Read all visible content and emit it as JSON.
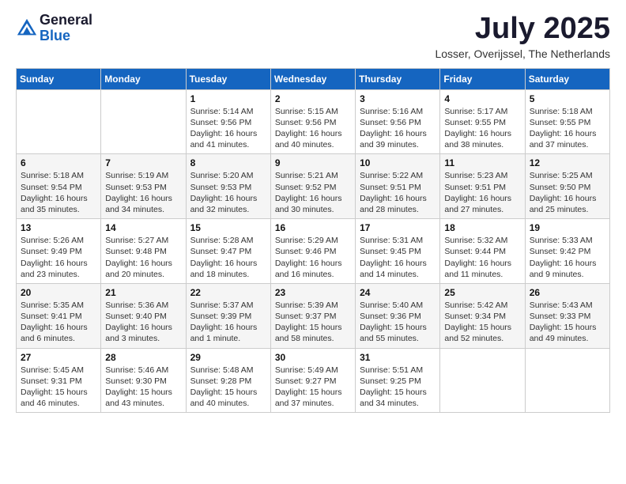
{
  "logo": {
    "general": "General",
    "blue": "Blue"
  },
  "header": {
    "month": "July 2025",
    "location": "Losser, Overijssel, The Netherlands"
  },
  "weekdays": [
    "Sunday",
    "Monday",
    "Tuesday",
    "Wednesday",
    "Thursday",
    "Friday",
    "Saturday"
  ],
  "weeks": [
    [
      {
        "day": "",
        "info": ""
      },
      {
        "day": "",
        "info": ""
      },
      {
        "day": "1",
        "info": "Sunrise: 5:14 AM\nSunset: 9:56 PM\nDaylight: 16 hours and 41 minutes."
      },
      {
        "day": "2",
        "info": "Sunrise: 5:15 AM\nSunset: 9:56 PM\nDaylight: 16 hours and 40 minutes."
      },
      {
        "day": "3",
        "info": "Sunrise: 5:16 AM\nSunset: 9:56 PM\nDaylight: 16 hours and 39 minutes."
      },
      {
        "day": "4",
        "info": "Sunrise: 5:17 AM\nSunset: 9:55 PM\nDaylight: 16 hours and 38 minutes."
      },
      {
        "day": "5",
        "info": "Sunrise: 5:18 AM\nSunset: 9:55 PM\nDaylight: 16 hours and 37 minutes."
      }
    ],
    [
      {
        "day": "6",
        "info": "Sunrise: 5:18 AM\nSunset: 9:54 PM\nDaylight: 16 hours and 35 minutes."
      },
      {
        "day": "7",
        "info": "Sunrise: 5:19 AM\nSunset: 9:53 PM\nDaylight: 16 hours and 34 minutes."
      },
      {
        "day": "8",
        "info": "Sunrise: 5:20 AM\nSunset: 9:53 PM\nDaylight: 16 hours and 32 minutes."
      },
      {
        "day": "9",
        "info": "Sunrise: 5:21 AM\nSunset: 9:52 PM\nDaylight: 16 hours and 30 minutes."
      },
      {
        "day": "10",
        "info": "Sunrise: 5:22 AM\nSunset: 9:51 PM\nDaylight: 16 hours and 28 minutes."
      },
      {
        "day": "11",
        "info": "Sunrise: 5:23 AM\nSunset: 9:51 PM\nDaylight: 16 hours and 27 minutes."
      },
      {
        "day": "12",
        "info": "Sunrise: 5:25 AM\nSunset: 9:50 PM\nDaylight: 16 hours and 25 minutes."
      }
    ],
    [
      {
        "day": "13",
        "info": "Sunrise: 5:26 AM\nSunset: 9:49 PM\nDaylight: 16 hours and 23 minutes."
      },
      {
        "day": "14",
        "info": "Sunrise: 5:27 AM\nSunset: 9:48 PM\nDaylight: 16 hours and 20 minutes."
      },
      {
        "day": "15",
        "info": "Sunrise: 5:28 AM\nSunset: 9:47 PM\nDaylight: 16 hours and 18 minutes."
      },
      {
        "day": "16",
        "info": "Sunrise: 5:29 AM\nSunset: 9:46 PM\nDaylight: 16 hours and 16 minutes."
      },
      {
        "day": "17",
        "info": "Sunrise: 5:31 AM\nSunset: 9:45 PM\nDaylight: 16 hours and 14 minutes."
      },
      {
        "day": "18",
        "info": "Sunrise: 5:32 AM\nSunset: 9:44 PM\nDaylight: 16 hours and 11 minutes."
      },
      {
        "day": "19",
        "info": "Sunrise: 5:33 AM\nSunset: 9:42 PM\nDaylight: 16 hours and 9 minutes."
      }
    ],
    [
      {
        "day": "20",
        "info": "Sunrise: 5:35 AM\nSunset: 9:41 PM\nDaylight: 16 hours and 6 minutes."
      },
      {
        "day": "21",
        "info": "Sunrise: 5:36 AM\nSunset: 9:40 PM\nDaylight: 16 hours and 3 minutes."
      },
      {
        "day": "22",
        "info": "Sunrise: 5:37 AM\nSunset: 9:39 PM\nDaylight: 16 hours and 1 minute."
      },
      {
        "day": "23",
        "info": "Sunrise: 5:39 AM\nSunset: 9:37 PM\nDaylight: 15 hours and 58 minutes."
      },
      {
        "day": "24",
        "info": "Sunrise: 5:40 AM\nSunset: 9:36 PM\nDaylight: 15 hours and 55 minutes."
      },
      {
        "day": "25",
        "info": "Sunrise: 5:42 AM\nSunset: 9:34 PM\nDaylight: 15 hours and 52 minutes."
      },
      {
        "day": "26",
        "info": "Sunrise: 5:43 AM\nSunset: 9:33 PM\nDaylight: 15 hours and 49 minutes."
      }
    ],
    [
      {
        "day": "27",
        "info": "Sunrise: 5:45 AM\nSunset: 9:31 PM\nDaylight: 15 hours and 46 minutes."
      },
      {
        "day": "28",
        "info": "Sunrise: 5:46 AM\nSunset: 9:30 PM\nDaylight: 15 hours and 43 minutes."
      },
      {
        "day": "29",
        "info": "Sunrise: 5:48 AM\nSunset: 9:28 PM\nDaylight: 15 hours and 40 minutes."
      },
      {
        "day": "30",
        "info": "Sunrise: 5:49 AM\nSunset: 9:27 PM\nDaylight: 15 hours and 37 minutes."
      },
      {
        "day": "31",
        "info": "Sunrise: 5:51 AM\nSunset: 9:25 PM\nDaylight: 15 hours and 34 minutes."
      },
      {
        "day": "",
        "info": ""
      },
      {
        "day": "",
        "info": ""
      }
    ]
  ]
}
